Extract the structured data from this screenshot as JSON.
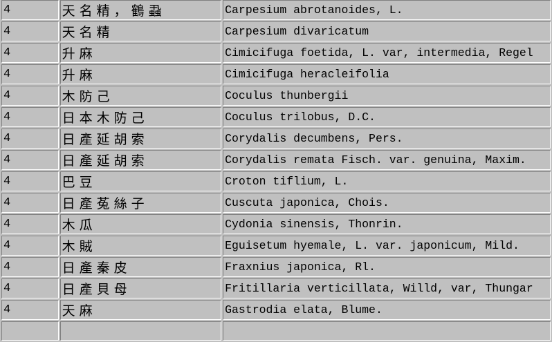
{
  "rows": [
    {
      "num": "4",
      "kanji": "天名精，鶴蝨",
      "latin": "Carpesium abrotanoides, L."
    },
    {
      "num": "4",
      "kanji": "天名精",
      "latin": "Carpesium divaricatum"
    },
    {
      "num": "4",
      "kanji": "升麻",
      "latin": "Cimicifuga foetida, L. var, intermedia, Regel"
    },
    {
      "num": "4",
      "kanji": "升麻",
      "latin": "Cimicifuga heracleifolia"
    },
    {
      "num": "4",
      "kanji": "木防己",
      "latin": "Coculus thunbergii"
    },
    {
      "num": "4",
      "kanji": "日本木防己",
      "latin": "Coculus trilobus, D.C."
    },
    {
      "num": "4",
      "kanji": "日產延胡索",
      "latin": "Corydalis decumbens, Pers."
    },
    {
      "num": "4",
      "kanji": "日產延胡索",
      "latin": "Corydalis remata Fisch. var. genuina, Maxim."
    },
    {
      "num": "4",
      "kanji": "巴豆",
      "latin": "Croton tiflium, L."
    },
    {
      "num": "4",
      "kanji": "日產菟絲子",
      "latin": "Cuscuta japonica, Chois."
    },
    {
      "num": "4",
      "kanji": "木瓜",
      "latin": "Cydonia sinensis, Thonrin."
    },
    {
      "num": "4",
      "kanji": "木賊",
      "latin": "Eguisetum hyemale, L. var. japonicum, Mild."
    },
    {
      "num": "4",
      "kanji": "日產秦皮",
      "latin": "Fraxnius japonica, Rl."
    },
    {
      "num": "4",
      "kanji": "日產貝母",
      "latin": "Fritillaria verticillata, Willd, var, Thungar"
    },
    {
      "num": "4",
      "kanji": "天麻",
      "latin": "Gastrodia elata, Blume."
    },
    {
      "num": "",
      "kanji": "",
      "latin": ""
    }
  ]
}
